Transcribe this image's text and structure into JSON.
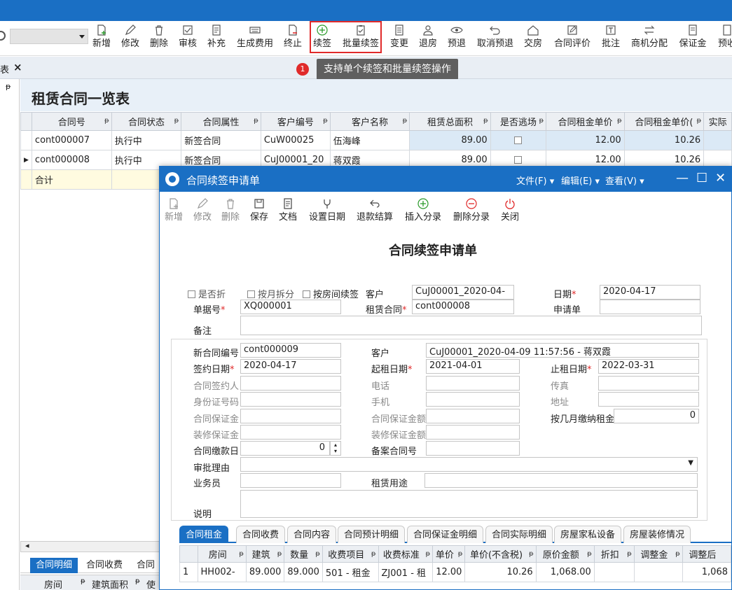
{
  "toolbar": {
    "buttons": [
      {
        "label": "新增",
        "icon": "plus-doc-icon"
      },
      {
        "label": "修改",
        "icon": "pencil-icon"
      },
      {
        "label": "删除",
        "icon": "trash-icon"
      },
      {
        "label": "审核",
        "icon": "check-icon"
      },
      {
        "label": "补充",
        "icon": "doc-icon"
      },
      {
        "label": "生成费用",
        "icon": "keyboard-icon"
      },
      {
        "label": "终止",
        "icon": "stop-doc-icon"
      },
      {
        "label": "续签",
        "icon": "plus-circle-icon"
      },
      {
        "label": "批量续签",
        "icon": "clipboard-check-icon"
      },
      {
        "label": "变更",
        "icon": "list-doc-icon"
      },
      {
        "label": "退房",
        "icon": "person-icon"
      },
      {
        "label": "预退",
        "icon": "eye-icon"
      },
      {
        "label": "取消预退",
        "icon": "undo-icon"
      },
      {
        "label": "交房",
        "icon": "home-icon"
      },
      {
        "label": "合同评价",
        "icon": "pencil-doc-icon"
      },
      {
        "label": "批注",
        "icon": "text-box-icon"
      },
      {
        "label": "商机分配",
        "icon": "swap-icon"
      },
      {
        "label": "保证金",
        "icon": "doc-icon"
      },
      {
        "label": "预收",
        "icon": "doc-icon"
      }
    ]
  },
  "tabstrip": {
    "fragment": "表",
    "close": "×"
  },
  "tooltip": {
    "number": "1",
    "text": "支持单个续签和批量续签操作"
  },
  "main": {
    "title": "租赁合同一览表",
    "columns": [
      "合同号",
      "合同状态",
      "合同属性",
      "客户编号",
      "客户名称",
      "租赁总面积",
      "是否逃场",
      "合同租金单价",
      "合同租金单价(",
      "实际"
    ],
    "rows": [
      [
        "cont000007",
        "执行中",
        "新签合同",
        "CuW00025",
        "伍海峰",
        "89.00",
        "",
        "12.00",
        "10.26",
        ""
      ],
      [
        "cont000008",
        "执行中",
        "新签合同",
        "CuJ00001_20",
        "蒋双霞",
        "89.00",
        "",
        "12.00",
        "10.26",
        ""
      ]
    ],
    "sum_label": "合计",
    "bottom_tabs": [
      "合同明细",
      "合同收费",
      "合同"
    ],
    "bottom_columns": [
      "房间",
      "建筑面积",
      "使"
    ]
  },
  "dialog": {
    "title": "合同续签申请单",
    "menus": [
      "文件(F)",
      "编辑(E)",
      "查看(V)"
    ],
    "controls": {
      "minimize": "—",
      "maximize": "☐",
      "close": "✕"
    },
    "toolbar": [
      {
        "label": "新增",
        "icon": "plus-doc-icon",
        "disabled": true
      },
      {
        "label": "修改",
        "icon": "pencil-icon",
        "disabled": true
      },
      {
        "label": "删除",
        "icon": "trash-icon",
        "disabled": true
      },
      {
        "label": "保存",
        "icon": "save-icon",
        "disabled": false
      },
      {
        "label": "文档",
        "icon": "doc-icon",
        "disabled": false
      },
      {
        "label": "设置日期",
        "icon": "calendar-icon",
        "disabled": false
      },
      {
        "label": "退款结算",
        "icon": "back-arrow-icon",
        "disabled": false
      },
      {
        "label": "插入分录",
        "icon": "plus-circle-icon",
        "disabled": false
      },
      {
        "label": "删除分录",
        "icon": "minus-circle-icon",
        "disabled": false
      },
      {
        "label": "关闭",
        "icon": "power-icon",
        "disabled": false
      }
    ],
    "form_title": "合同续签申请单",
    "header": {
      "chk_discount": "是否折",
      "chk_split": "按月拆分",
      "chk_room": "按房间续签",
      "customer_label": "客户",
      "customer_value": "CuJ00001_2020-04-",
      "date_label": "日期",
      "date_value": "2020-04-17",
      "doc_no_label": "单据号",
      "doc_no_value": "XQ000001",
      "lease_contract_label": "租赁合同",
      "lease_contract_value": "cont000008",
      "apply_label": "申请单",
      "apply_value": "",
      "remark_label": "备注"
    },
    "section": {
      "new_contract_no_label": "新合同编号",
      "new_contract_no_value": "cont000009",
      "customer_label": "客户",
      "customer_value": "CuJ00001_2020-04-09 11:57:56 - 蒋双霞",
      "sign_date_label": "签约日期",
      "sign_date_value": "2020-04-17",
      "start_date_label": "起租日期",
      "start_date_value": "2021-04-01",
      "end_date_label": "止租日期",
      "end_date_value": "2022-03-31",
      "signer_label": "合同签约人",
      "phone_label": "电话",
      "fax_label": "传真",
      "id_label": "身份证号码",
      "mobile_label": "手机",
      "address_label": "地址",
      "deposit_label": "合同保证金",
      "deposit_amount_label": "合同保证金额",
      "months_rent_label": "按几月缴纳租金",
      "months_rent_value": "0",
      "deco_deposit_label": "装修保证金",
      "deco_deposit_amount_label": "装修保证金额",
      "pay_day_label": "合同缴款日",
      "pay_day_value": "0",
      "record_no_label": "备案合同号",
      "approve_reason_label": "审批理由",
      "salesman_label": "业务员",
      "usage_label": "租赁用途",
      "note_label": "说明"
    },
    "tabs": [
      "合同租金",
      "合同收费",
      "合同内容",
      "合同预计明细",
      "合同保证金明细",
      "合同实际明细",
      "房屋家私设备",
      "房屋装修情况"
    ],
    "grid": {
      "columns": [
        "房间",
        "建筑",
        "数量",
        "收费项目",
        "收费标准",
        "单价",
        "单价(不含税)",
        "原价金额",
        "折扣",
        "调整金",
        "调整后"
      ],
      "rows": [
        {
          "idx": "1",
          "cells": [
            "HH002-",
            "89.000",
            "89.000",
            "501 - 租金",
            "ZJ001 - 租",
            "12.00",
            "10.26",
            "1,068.00",
            "",
            "",
            "1,068"
          ]
        }
      ]
    }
  },
  "colors": {
    "accent": "#1a6fc4",
    "highlight": "#e02a2a",
    "selected_row": "#dbe9f6",
    "sum_row": "#fffbe0"
  }
}
